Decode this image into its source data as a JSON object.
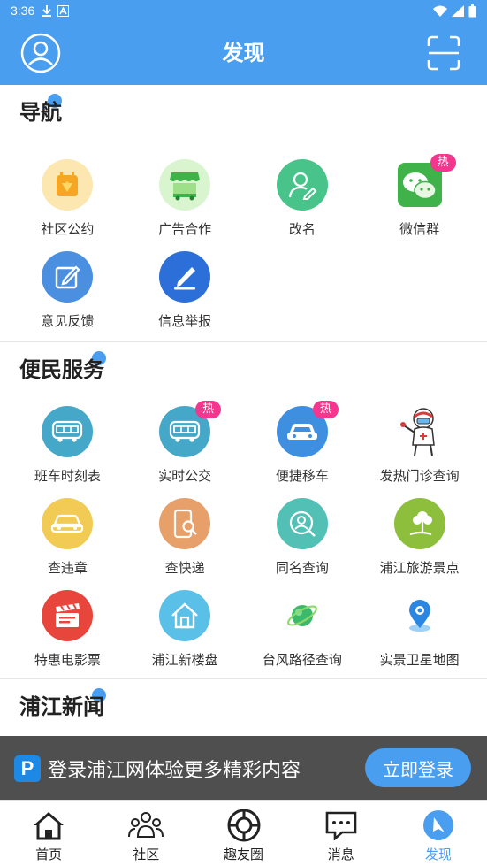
{
  "status_bar": {
    "time": "3:36"
  },
  "header": {
    "title": "发现"
  },
  "sections": {
    "nav": {
      "title": "导航",
      "items": [
        {
          "label": "社区公约",
          "icon": "community-rules-icon",
          "color": "#fde7b0"
        },
        {
          "label": "广告合作",
          "icon": "ad-stall-icon",
          "color": "#d8f5d0"
        },
        {
          "label": "改名",
          "icon": "rename-user-icon",
          "color": "#48c48a"
        },
        {
          "label": "微信群",
          "icon": "wechat-icon",
          "color": "#3fb24a",
          "badge": "热"
        },
        {
          "label": "意见反馈",
          "icon": "feedback-edit-icon",
          "color": "#4a8fe0"
        },
        {
          "label": "信息举报",
          "icon": "report-pen-icon",
          "color": "#2c6fd8"
        }
      ]
    },
    "services": {
      "title": "便民服务",
      "items": [
        {
          "label": "班车时刻表",
          "icon": "bus-icon",
          "color": "#45a8c8"
        },
        {
          "label": "实时公交",
          "icon": "bus-icon",
          "color": "#45a8c8",
          "badge": "热"
        },
        {
          "label": "便捷移车",
          "icon": "car-icon",
          "color": "#3f8fe0",
          "badge": "热"
        },
        {
          "label": "发热门诊查询",
          "icon": "medic-figure-icon",
          "color": "#ffffff"
        },
        {
          "label": "查违章",
          "icon": "car-icon",
          "color": "#f2cb55"
        },
        {
          "label": "查快递",
          "icon": "phone-search-icon",
          "color": "#e7a06a"
        },
        {
          "label": "同名查询",
          "icon": "person-search-icon",
          "color": "#52c0b5"
        },
        {
          "label": "浦江旅游景点",
          "icon": "tree-icon",
          "color": "#8dbf3c"
        },
        {
          "label": "特惠电影票",
          "icon": "clapperboard-icon",
          "color": "#e8453c"
        },
        {
          "label": "浦江新楼盘",
          "icon": "house-icon",
          "color": "#5bc0e8"
        },
        {
          "label": "台风路径查询",
          "icon": "planet-icon",
          "color": "#3cb96a"
        },
        {
          "label": "实景卫星地图",
          "icon": "map-pin-icon",
          "color": "#2a86e0"
        }
      ]
    },
    "news": {
      "title": "浦江新闻"
    }
  },
  "login_banner": {
    "logo": "P",
    "message": "登录浦江网体验更多精彩内容",
    "button": "立即登录"
  },
  "tabbar": {
    "items": [
      {
        "label": "首页",
        "icon": "home-icon"
      },
      {
        "label": "社区",
        "icon": "community-icon"
      },
      {
        "label": "趣友圈",
        "icon": "friends-circle-icon"
      },
      {
        "label": "消息",
        "icon": "message-icon"
      },
      {
        "label": "发现",
        "icon": "discover-compass-icon",
        "active": true
      }
    ]
  },
  "colors": {
    "accent": "#4a9eef",
    "hot_badge": "#f4368e"
  }
}
